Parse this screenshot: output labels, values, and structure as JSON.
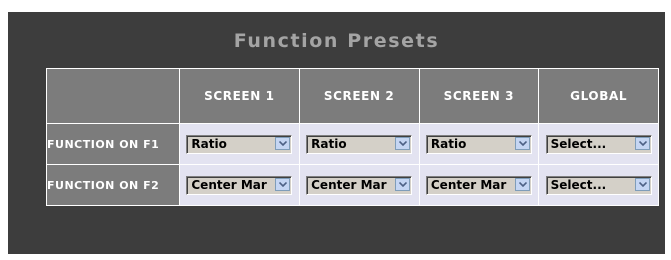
{
  "title": "Function Presets",
  "columns": [
    "SCREEN 1",
    "SCREEN 2",
    "SCREEN 3",
    "GLOBAL"
  ],
  "rows": [
    {
      "label": "FUNCTION ON F1",
      "values": [
        "Ratio",
        "Ratio",
        "Ratio",
        "Select..."
      ]
    },
    {
      "label": "FUNCTION ON F2",
      "values": [
        "Center Mar",
        "Center Mar",
        "Center Mar",
        "Select..."
      ]
    }
  ],
  "icons": {
    "dropdown_arrow": "chevron-down-icon"
  },
  "colors": {
    "panel_background": "#3d3d3d",
    "header_cell": "#7c7c7c",
    "data_cell": "#e3e3f1",
    "title_text": "#a4a4a4",
    "arrow_button": "#c5d6f3",
    "arrow_glyph": "#4d6185"
  }
}
